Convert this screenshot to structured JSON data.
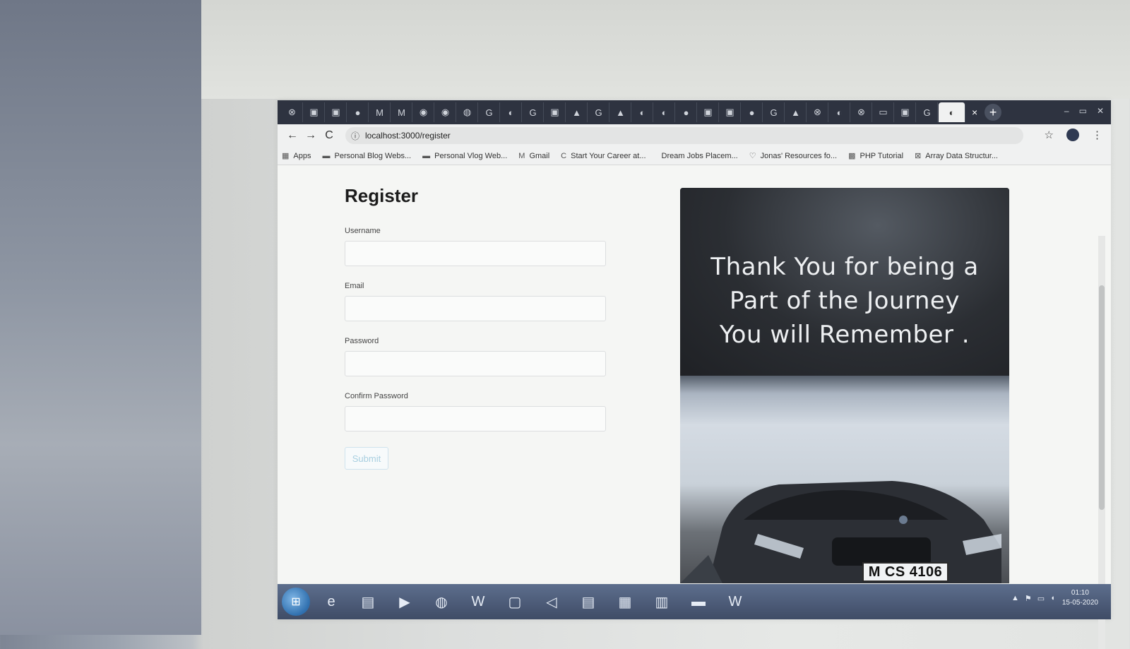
{
  "browser": {
    "tab_icons": [
      "⊗",
      "▣",
      "▣",
      "●",
      "M",
      "M",
      "◉",
      "◉",
      "◍",
      "G",
      "◐",
      "G",
      "▣",
      "▲",
      "G",
      "▲",
      "◐",
      "◐",
      "●",
      "▣",
      "▣",
      "●",
      "G",
      "▲",
      "⊗",
      "◐",
      "⊗",
      "▭",
      "▣",
      "G",
      "◐"
    ],
    "tab_close": "×",
    "new_tab": "+",
    "window_controls": [
      "–",
      "▭",
      "✕"
    ],
    "back": "←",
    "forward": "→",
    "reload": "C",
    "info_icon": "ⓘ",
    "url": "localhost:3000/register",
    "star": "☆",
    "menu": "⋮",
    "bookmarks": [
      {
        "icon": "▦",
        "label": "Apps"
      },
      {
        "icon": "▬",
        "label": "Personal Blog Webs..."
      },
      {
        "icon": "▬",
        "label": "Personal Vlog Web..."
      },
      {
        "icon": "M",
        "label": "Gmail"
      },
      {
        "icon": "C",
        "label": "Start Your Career at..."
      },
      {
        "icon": "",
        "label": "Dream Jobs Placem..."
      },
      {
        "icon": "♡",
        "label": "Jonas' Resources fo..."
      },
      {
        "icon": "▩",
        "label": "PHP Tutorial"
      },
      {
        "icon": "⊠",
        "label": "Array Data Structur..."
      }
    ]
  },
  "form": {
    "title": "Register",
    "username_label": "Username",
    "email_label": "Email",
    "password_label": "Password",
    "confirm_label": "Confirm Password",
    "submit_label": "Submit"
  },
  "hero": {
    "line1": "Thank You for being a",
    "line2": "Part of the Journey",
    "line3": "You will Remember .",
    "plate": "M CS 4106"
  },
  "taskbar": {
    "start": "⊞",
    "apps": [
      "e",
      "▤",
      "▶",
      "◍",
      "W",
      "▢",
      "◁",
      "▤",
      "▦",
      "▥",
      "▬",
      "W"
    ],
    "tray_icons": [
      "▲",
      "⚑",
      "▭",
      "◖"
    ],
    "time": "01:10",
    "date": "15-05-2020"
  },
  "colors": {
    "tabstrip": "#2e3340",
    "taskbar": "#3f4c66",
    "submit_text": "#a8cfe0"
  }
}
